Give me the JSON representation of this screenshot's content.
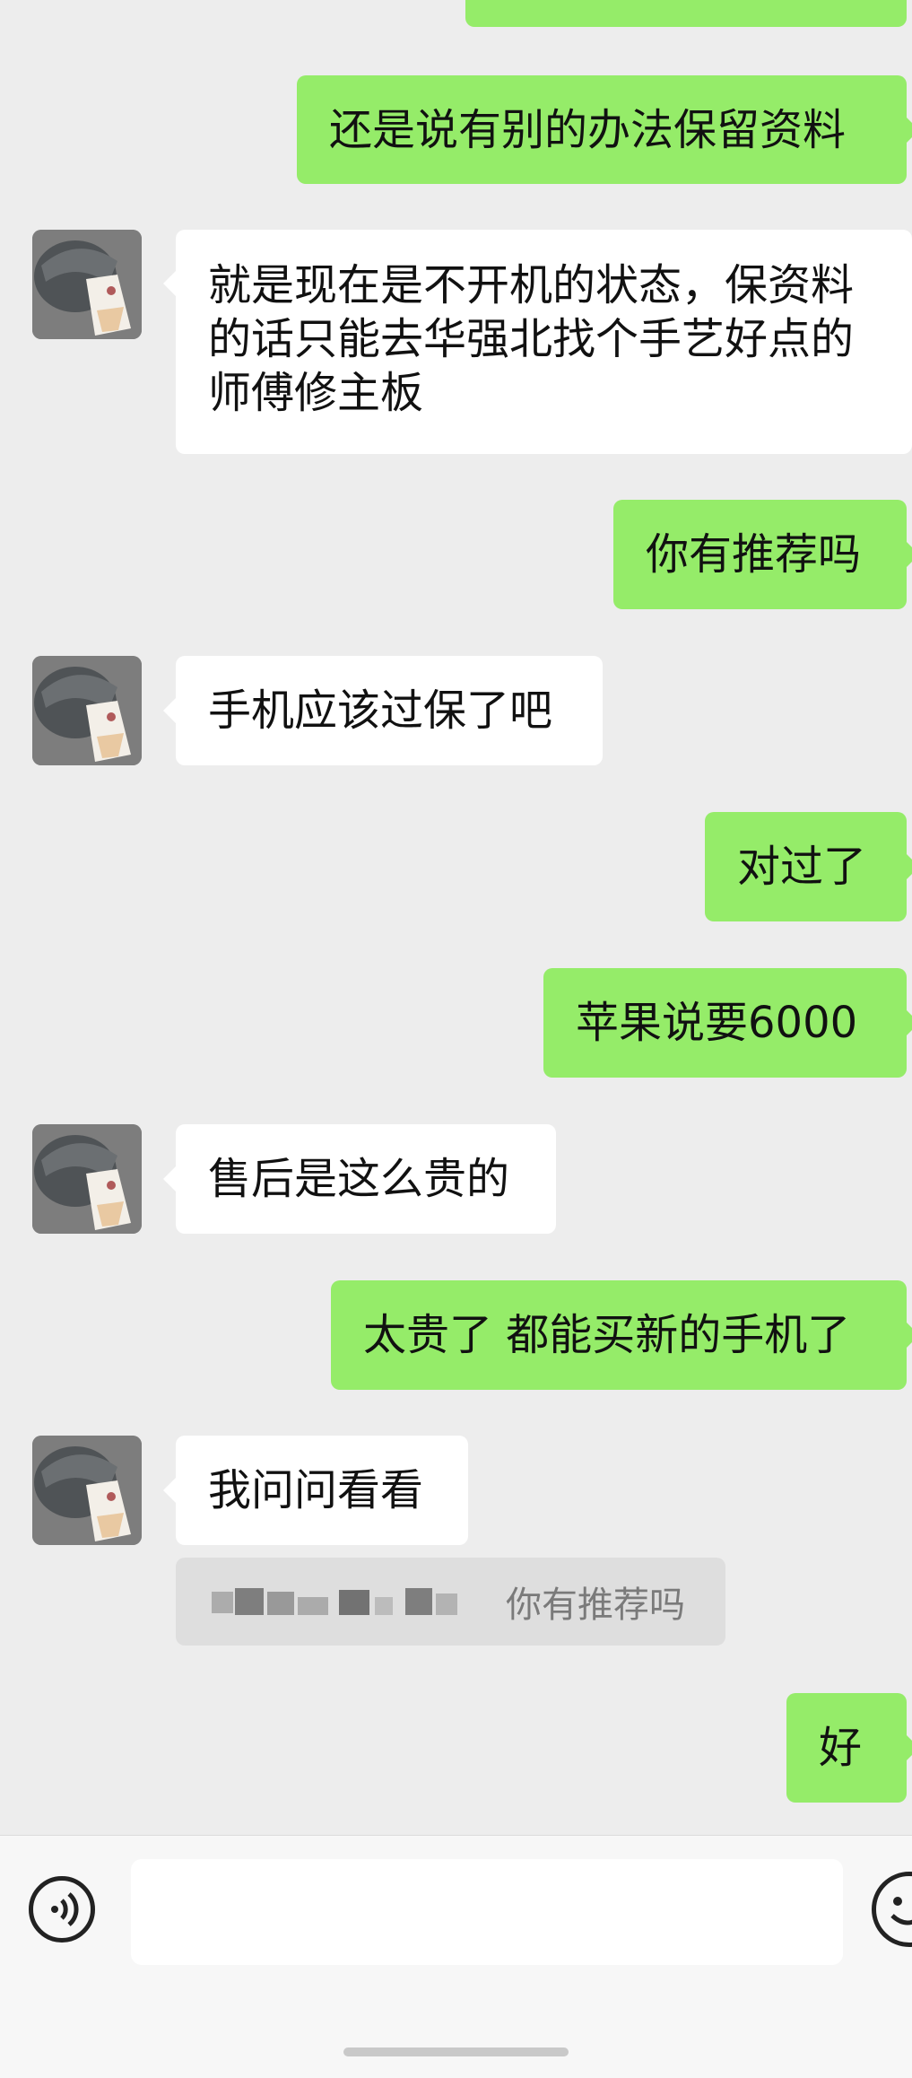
{
  "messages": [
    {
      "side": "sent",
      "text": "还是说有别的办法保留资料"
    },
    {
      "side": "recv",
      "lines": [
        "就是现在是不开机的状态，保资料",
        "的话只能去华强北找个手艺好点的",
        "师傅修主板"
      ]
    },
    {
      "side": "sent",
      "text": "你有推荐吗"
    },
    {
      "side": "recv",
      "text": "手机应该过保了吧"
    },
    {
      "side": "sent",
      "text": "对过了"
    },
    {
      "side": "sent",
      "text": "苹果说要6000"
    },
    {
      "side": "recv",
      "text": "售后是这么贵的"
    },
    {
      "side": "sent",
      "text": "太贵了 都能买新的手机了"
    },
    {
      "side": "recv",
      "text": "我问问看看"
    },
    {
      "side": "sent",
      "text": "好"
    }
  ],
  "quote": {
    "text": "你有推荐吗"
  },
  "colors": {
    "sent_bubble": "#95ec69",
    "received_bubble": "#ffffff",
    "background": "#ededed"
  },
  "icons": {
    "voice": "voice-input-icon",
    "emoji": "emoji-icon"
  }
}
